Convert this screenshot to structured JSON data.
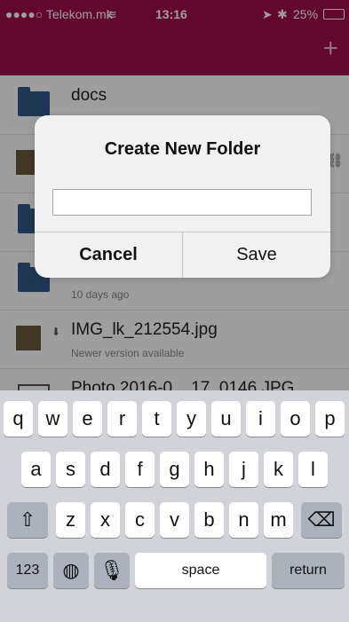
{
  "status_bar": {
    "carrier": "●●●●○ Telekom.mk",
    "wifi": "wifi-icon",
    "time": "13:16",
    "battery": "25%"
  },
  "nav": {
    "add_label": "+"
  },
  "files": [
    {
      "name": "docs",
      "sub": ""
    },
    {
      "name": "",
      "sub": ""
    },
    {
      "name": "",
      "sub": ""
    },
    {
      "name": "folder",
      "sub": "10 days ago"
    },
    {
      "name": "IMG_lk_212554.jpg",
      "sub": "Newer version available"
    },
    {
      "name": "Photo 2016-0... 17_0146.JPG",
      "sub": ""
    }
  ],
  "dialog": {
    "title": "Create New Folder",
    "input_value": "",
    "cancel": "Cancel",
    "save": "Save"
  },
  "keyboard": {
    "row1": [
      "q",
      "w",
      "e",
      "r",
      "t",
      "y",
      "u",
      "i",
      "o",
      "p"
    ],
    "row2": [
      "a",
      "s",
      "d",
      "f",
      "g",
      "h",
      "j",
      "k",
      "l"
    ],
    "row3": [
      "z",
      "x",
      "c",
      "v",
      "b",
      "n",
      "m"
    ],
    "num": "123",
    "space": "space",
    "return": "return"
  }
}
